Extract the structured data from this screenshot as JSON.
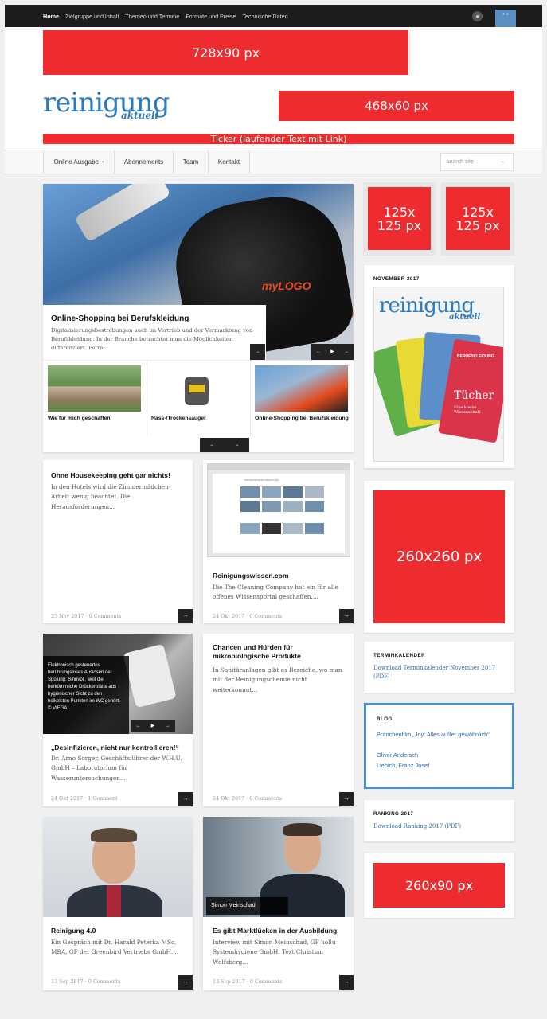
{
  "topbar": {
    "nav": [
      "Home",
      "Zielgruppe und Inhalt",
      "Themen und Termine",
      "Formate und Preise",
      "Technische Daten"
    ],
    "rss_icon": "rss-icon",
    "ribbon_icon": "bookmark-ribbon-icon",
    "ribbon_text": "* *"
  },
  "header": {
    "ad_top": "728x90 px",
    "logo_main": "reinigung",
    "logo_sub": "aktuell",
    "ad_right": "468x60 px",
    "ticker": "Ticker (laufender Text mit Link)"
  },
  "mainnav": {
    "items": [
      "Online Ausgabe",
      "Abonnements",
      "Team",
      "Kontakt"
    ],
    "dropdown_icon": "chevron-down-icon",
    "search_placeholder": "search site",
    "search_arrow": "→"
  },
  "hero": {
    "title": "Online-Shopping bei Berufskleidung",
    "excerpt": "Digitalisierungsbestrebungen auch im Vertrieb und der Vermarktung von Berufskleidung. In der Branche betrachtet man die Möglichkeiten differenziert. Petra...",
    "photo_caption": "myLOGO",
    "arrow": "→",
    "controls": [
      "←",
      "▶",
      "→"
    ],
    "thumbs": [
      {
        "title": "Wie für mich geschaffen"
      },
      {
        "title": "Nass-/Trockensauger"
      },
      {
        "title": "Online-Shopping bei Berufskleidung"
      }
    ],
    "thumb_controls": [
      "←",
      "→"
    ]
  },
  "articles": [
    {
      "title": "Ohne Housekeeping geht gar nichts!",
      "excerpt": "In den Hotels wird die Zimmermädchen-Arbeit wenig beachtet. Die Herausforderungen...",
      "meta": "23 Nov 2017 · 0 Comments",
      "arrow": "→"
    },
    {
      "title": "Reinigungswissen.com",
      "excerpt": "Die The Cleaning Company hat ein für alle offenes Wissensportal geschaffen....",
      "meta": "24 Okt 2017 · 0 Comments",
      "arrow": "→",
      "screenshot_heading": "WISSENSPORTAL REINIGUNG"
    },
    {
      "title": "„Desinfizieren, nicht nur kontrollieren!“",
      "excerpt": "Dr. Arno Sorger, Geschäftsführer der W.H.U. GmbH – Laboratorium für Wasseruntersuchungen...",
      "meta": "24 Okt 2017 · 1 Comment",
      "arrow": "→",
      "caption": "Elektronisch gesteuertes berührungsloses Auslösen der Spülung: Sinnvoll, weil die herkömmliche Drückerplatte aus hygienischer Sicht zu den heikelsten Punkten im WC gehört. © VIEGA",
      "controls": [
        "←",
        "▶",
        "→"
      ]
    },
    {
      "title": "Chancen und Hürden für mikrobiologische Produkte",
      "excerpt": "In Sanitäranlagen gibt es Bereiche, wo man mit der Reinigungschemie nicht weiterkommt...",
      "meta": "24 Okt 2017 · 0 Comments",
      "arrow": "→"
    },
    {
      "title": "Reinigung 4.0",
      "excerpt": "Ein Gespräch mit Dr. Harald Peterka MSc, MBA, GF der Greenbird Vertriebs GmbH...",
      "meta": "13 Sep 2017 · 0 Comments",
      "arrow": "→"
    },
    {
      "title": "Es gibt Marktlücken in der Ausbildung",
      "excerpt": "Interview mit Simon Meinschad, GF hollu Systemhygiene GmbH. Text Christian Wolfsberg...",
      "meta": "13 Sep 2017 · 0 Comments",
      "arrow": "→",
      "caption": "Simon Meinschad"
    }
  ],
  "sidebar": {
    "ad_small_1": "125x\n125 px",
    "ad_small_2": "125x\n125 px",
    "issue_title": "NOVEMBER 2017",
    "cover_logo": "reinigung",
    "cover_sub": "aktuell",
    "cover_text": "Tücher",
    "cover_subtext": "Eine kleine Wissenschaft",
    "cover_tag": "BERUFSKLEIDUNG",
    "ad_260": "260x260 px",
    "termine_title": "TERMINKALENDER",
    "termine_link": "Download Terminkalender November 2017 (PDF)",
    "blog_title": "BLOG",
    "blog_links": [
      "Branchenfilm „Joy: Alles außer gewöhnlich“",
      "Oliver Andersch",
      "Liebich, Franz Josef"
    ],
    "ranking_title": "RANKING 2017",
    "ranking_link": "Download Ranking 2017 (PDF)",
    "ad_bottom": "260x90 px"
  },
  "colors": {
    "accent_red": "#ee2b2e",
    "brand_blue": "#2c7bbf",
    "dark": "#1c1c1c"
  }
}
